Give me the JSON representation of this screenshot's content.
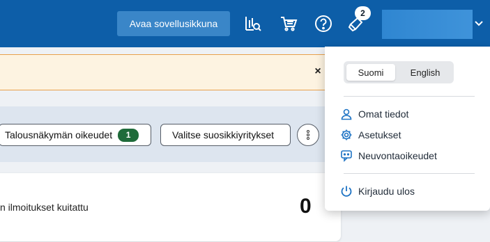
{
  "header": {
    "open_app_label": "Avaa sovellusikkuna",
    "notifications_count": "2",
    "icons": [
      "chart-search-icon",
      "cart-icon",
      "help-icon",
      "megaphone-icon",
      "chevron-down-icon"
    ]
  },
  "alert": {
    "close_label": "×"
  },
  "toolbar": {
    "finance_rights_label": "Talousnäkymän oikeudet",
    "finance_rights_count": "1",
    "select_favorites_label": "Valitse suosikkiyritykset"
  },
  "card": {
    "label": "n ilmoitukset kuitattu",
    "value": "0"
  },
  "menu": {
    "languages": [
      "Suomi",
      "English"
    ],
    "selected_language": "Suomi",
    "items": [
      {
        "label": "Omat tiedot",
        "icon": "user-icon"
      },
      {
        "label": "Asetukset",
        "icon": "gear-icon"
      },
      {
        "label": "Neuvontaoikeudet",
        "icon": "support-chat-icon"
      },
      {
        "label": "Kirjaudu ulos",
        "icon": "power-icon"
      }
    ]
  },
  "colors": {
    "header_bg": "#0d5ea8",
    "accent": "#1e73c4",
    "alert_bg": "#fdf3e1",
    "alert_border": "#e8a04a",
    "count_badge": "#1f6b3a"
  }
}
